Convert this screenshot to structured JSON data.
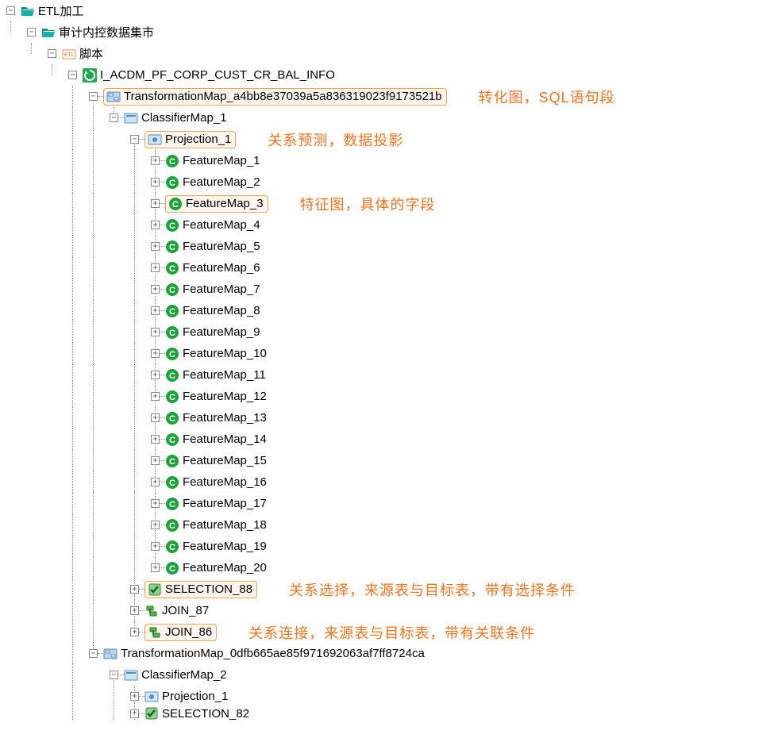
{
  "tree": {
    "root": {
      "label": "ETL加工"
    },
    "level1": {
      "label": "审计内控数据集市"
    },
    "level2": {
      "label": "脚本"
    },
    "level3": {
      "label": "I_ACDM_PF_CORP_CUST_CR_BAL_INFO"
    },
    "tmap1": {
      "label": "TransformationMap_a4bb8e37039a5a836319023f9173521b"
    },
    "cmap1": {
      "label": "ClassifierMap_1"
    },
    "proj1": {
      "label": "Projection_1"
    },
    "features": [
      "FeatureMap_1",
      "FeatureMap_2",
      "FeatureMap_3",
      "FeatureMap_4",
      "FeatureMap_5",
      "FeatureMap_6",
      "FeatureMap_7",
      "FeatureMap_8",
      "FeatureMap_9",
      "FeatureMap_10",
      "FeatureMap_11",
      "FeatureMap_12",
      "FeatureMap_13",
      "FeatureMap_14",
      "FeatureMap_15",
      "FeatureMap_16",
      "FeatureMap_17",
      "FeatureMap_18",
      "FeatureMap_19",
      "FeatureMap_20"
    ],
    "sel88": {
      "label": "SELECTION_88"
    },
    "join87": {
      "label": "JOIN_87"
    },
    "join86": {
      "label": "JOIN_86"
    },
    "tmap2": {
      "label": "TransformationMap_0dfb665ae85f971692063af7ff8724ca"
    },
    "cmap2": {
      "label": "ClassifierMap_2"
    },
    "proj2": {
      "label": "Projection_1"
    },
    "sel82": {
      "label": "SELECTION_82"
    }
  },
  "annotations": {
    "tmap1": "转化图，SQL语句段",
    "proj1": "关系预测，数据投影",
    "fm3": "特征图，具体的字段",
    "sel88": "关系选择，来源表与目标表，带有选择条件",
    "join86": "关系连接，来源表与目标表，带有关联条件"
  },
  "toggles": {
    "plus": "+",
    "minus": "−"
  }
}
